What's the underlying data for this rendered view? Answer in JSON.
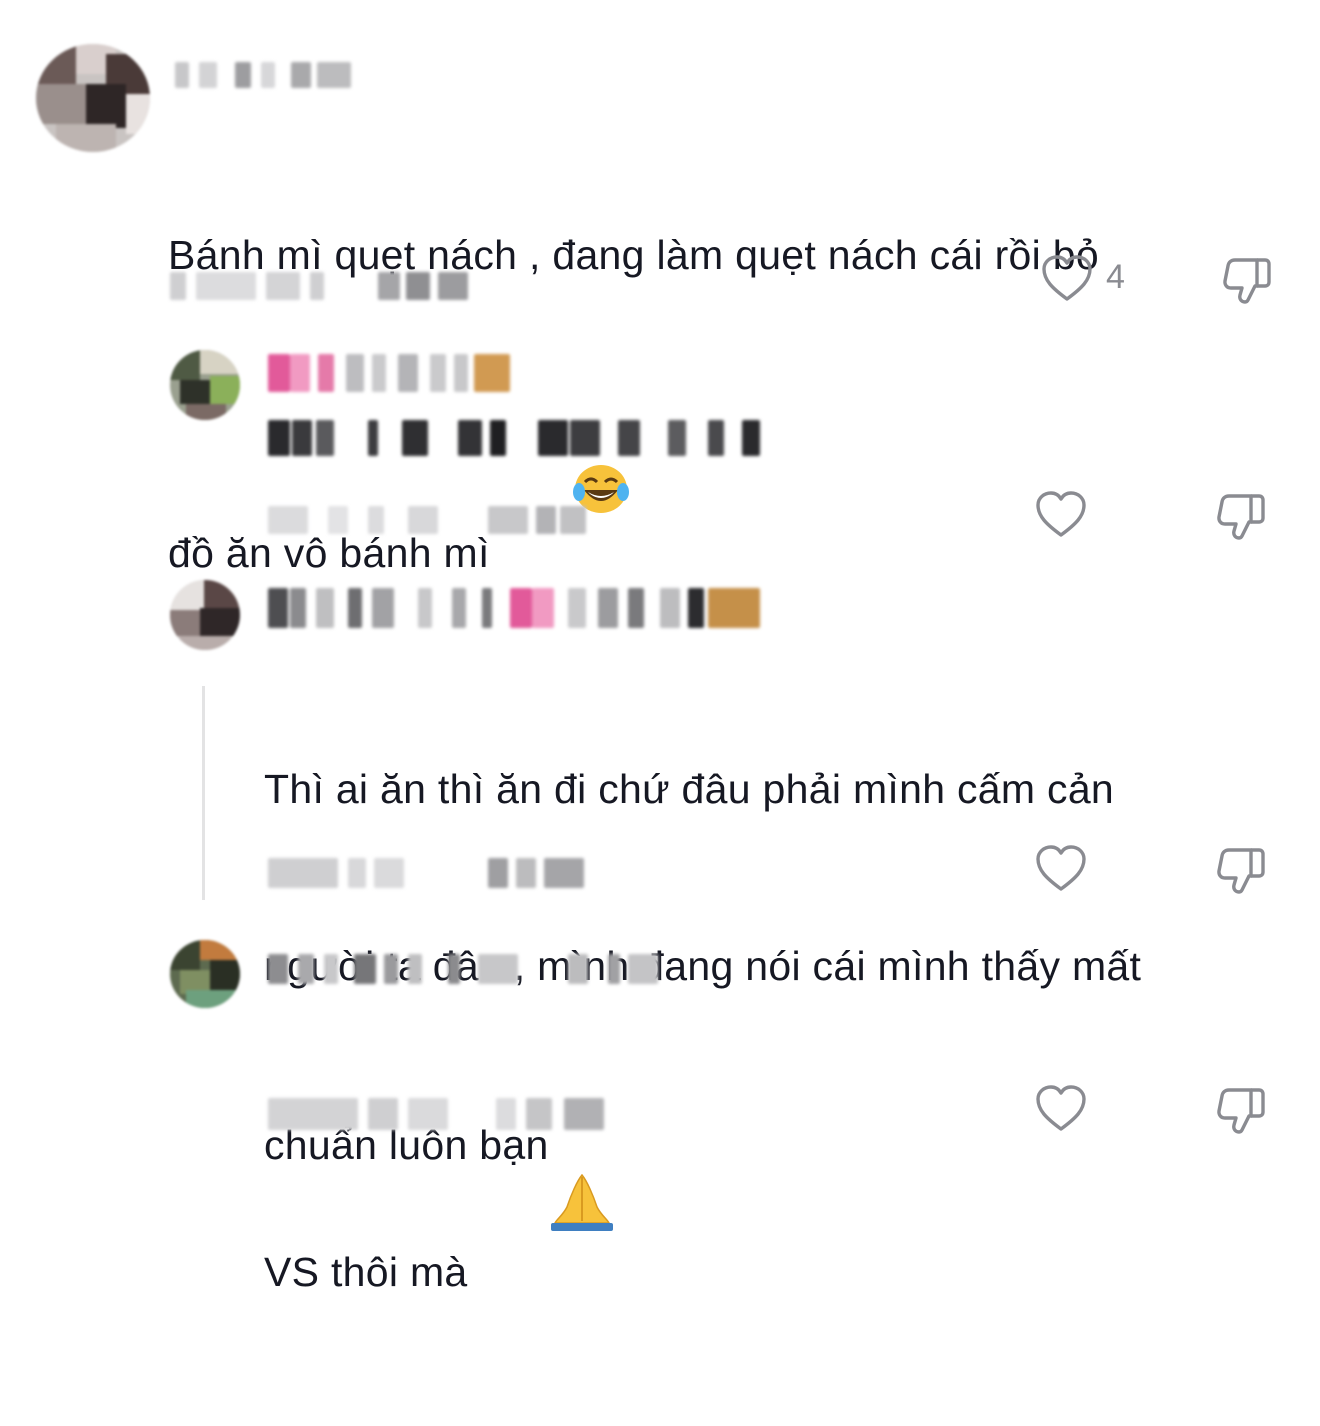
{
  "comments": [
    {
      "text_line1": "Bánh mì quẹt nách , đang làm quẹt nách cái rồi bỏ",
      "text_line2": "đồ ăn vô bánh mì",
      "emoji": "face-with-tears-of-joy",
      "like_count": "4"
    },
    {
      "text": ""
    },
    {
      "text_line1": "Thì ai ăn thì ăn đi chứ đâu phải mình cấm cản",
      "text_line2": "người ta đâu , mình đang nói cái mình thấy mất",
      "text_line3": "VS thôi mà",
      "emoji": "folded-hands"
    },
    {
      "text_line1": "chuẩn luôn bạn"
    }
  ],
  "icons": {
    "like": "heart-outline-icon",
    "dislike": "thumbs-down-outline-icon"
  },
  "colors": {
    "text": "#161823",
    "icon": "#8a8b91",
    "thread_line": "#e3e3e4"
  }
}
